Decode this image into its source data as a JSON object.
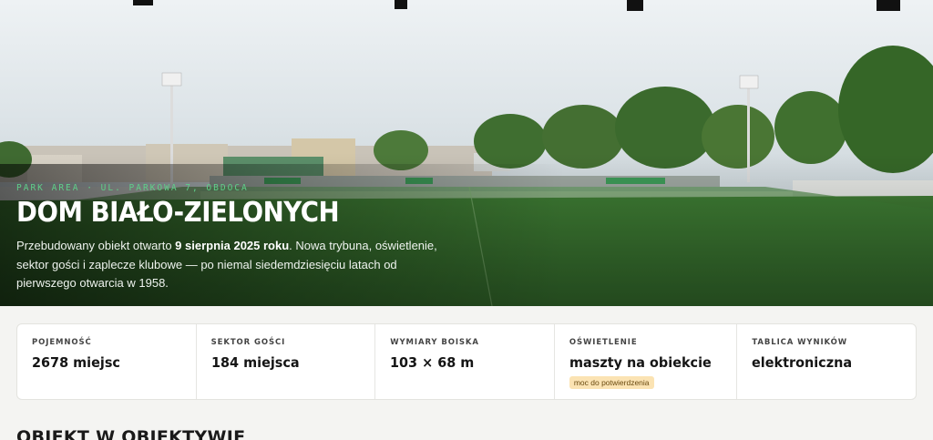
{
  "hero": {
    "eyebrow": "PARK AREA · UL. PARKOWA 7, OBDOCA",
    "title": "DOM BIAŁO-ZIELONYCH",
    "desc_before": "Przebudowany obiekt otwarto ",
    "desc_bold": "9 sierpnia 2025 roku",
    "desc_after": ". Nowa trybuna, oświetlenie, sektor gości i zaplecze klubowe — po niemal siedemdziesięciu latach od pierwszego otwarcia w 1958."
  },
  "stats": [
    {
      "label": "POJEMNOŚĆ",
      "value": "2678 miejsc"
    },
    {
      "label": "SEKTOR GOŚCI",
      "value": "184 miejsca"
    },
    {
      "label": "WYMIARY BOISKA",
      "value": "103 × 68 m"
    },
    {
      "label": "OŚWIETLENIE",
      "value": "maszty na obiekcie",
      "note": "moc do potwierdzenia"
    },
    {
      "label": "TABLICA WYNIKÓW",
      "value": "elektroniczna"
    }
  ],
  "section": {
    "title": "OBIEKT W OBIEKTYWIE"
  },
  "colors": {
    "accent_green": "#5fd08a",
    "note_bg": "#fbe3b3"
  }
}
